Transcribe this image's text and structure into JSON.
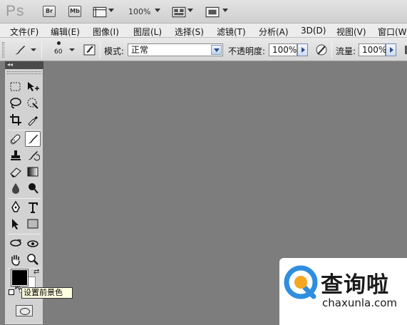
{
  "app": {
    "logo": "Ps"
  },
  "appbar": {
    "bridge_label": "Br",
    "minibridge_label": "Mb",
    "zoom_level": "100%"
  },
  "menu": [
    "文件(F)",
    "编辑(E)",
    "图像(I)",
    "图层(L)",
    "选择(S)",
    "滤镜(T)",
    "分析(A)",
    "3D(D)",
    "视图(V)",
    "窗口(W)"
  ],
  "options": {
    "brush_size": "60",
    "mode_label": "模式:",
    "mode_value": "正常",
    "opacity_label": "不透明度:",
    "opacity_value": "100%",
    "flow_label": "流量:",
    "flow_value": "100%"
  },
  "toolbox": {
    "header": "◂◂",
    "tooltip": "设置前景色",
    "foreground_color": "#000000",
    "background_color": "#ffffff"
  },
  "watermark": {
    "title": "查询啦",
    "url": "chaxunla.com",
    "brand_blue": "#2f8ee0",
    "brand_orange": "#f5a623"
  },
  "colors": {
    "canvas": "#7d7d7d",
    "toolbox": "#d2d2d2"
  }
}
